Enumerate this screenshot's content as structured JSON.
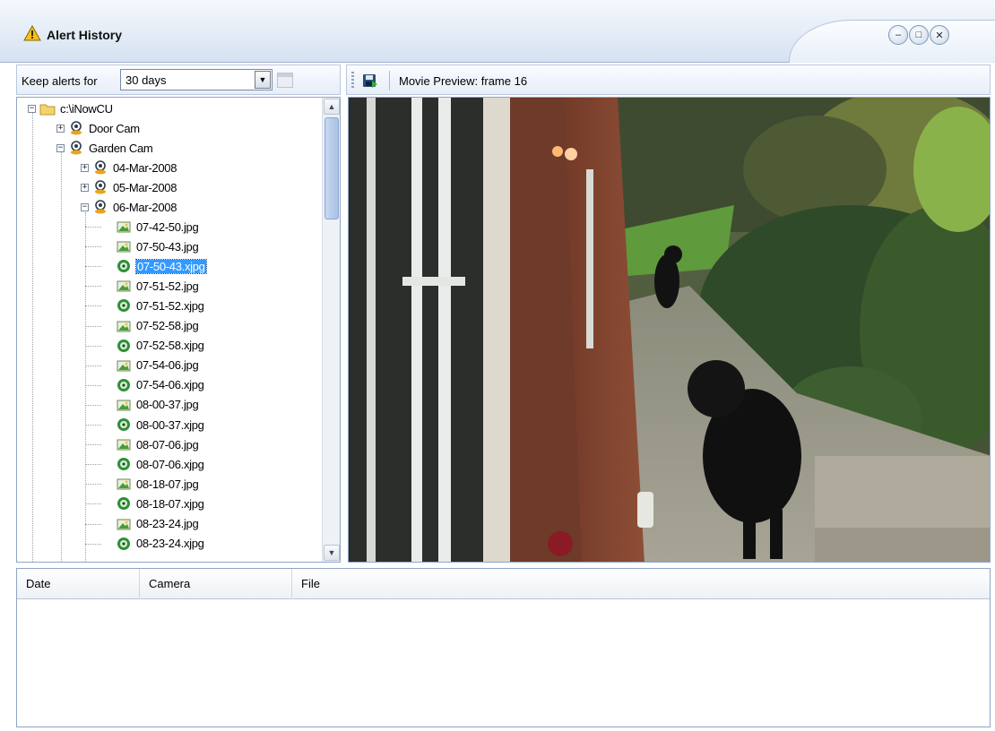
{
  "window": {
    "title": "Alert History",
    "controls": [
      "minimize",
      "maximize",
      "close"
    ]
  },
  "left_toolbar": {
    "keep_label": "Keep alerts for",
    "keep_value": "30 days"
  },
  "preview_toolbar": {
    "title": "Movie Preview: frame 16"
  },
  "tree": {
    "root": "c:\\iNowCU",
    "cameras": [
      "Door Cam",
      "Garden Cam"
    ],
    "dates": [
      "04-Mar-2008",
      "05-Mar-2008",
      "06-Mar-2008"
    ],
    "files": [
      {
        "name": "07-42-50.jpg",
        "kind": "jpg"
      },
      {
        "name": "07-50-43.jpg",
        "kind": "jpg"
      },
      {
        "name": "07-50-43.xjpg",
        "kind": "xjpg",
        "selected": true
      },
      {
        "name": "07-51-52.jpg",
        "kind": "jpg"
      },
      {
        "name": "07-51-52.xjpg",
        "kind": "xjpg"
      },
      {
        "name": "07-52-58.jpg",
        "kind": "jpg"
      },
      {
        "name": "07-52-58.xjpg",
        "kind": "xjpg"
      },
      {
        "name": "07-54-06.jpg",
        "kind": "jpg"
      },
      {
        "name": "07-54-06.xjpg",
        "kind": "xjpg"
      },
      {
        "name": "08-00-37.jpg",
        "kind": "jpg"
      },
      {
        "name": "08-00-37.xjpg",
        "kind": "xjpg"
      },
      {
        "name": "08-07-06.jpg",
        "kind": "jpg"
      },
      {
        "name": "08-07-06.xjpg",
        "kind": "xjpg"
      },
      {
        "name": "08-18-07.jpg",
        "kind": "jpg"
      },
      {
        "name": "08-18-07.xjpg",
        "kind": "xjpg"
      },
      {
        "name": "08-23-24.jpg",
        "kind": "jpg"
      },
      {
        "name": "08-23-24.xjpg",
        "kind": "xjpg"
      }
    ]
  },
  "alert_list": {
    "columns": [
      "Date",
      "Camera",
      "File"
    ],
    "rows": []
  },
  "colors": {
    "selection": "#3399ff",
    "chrome": "#d6e2f1",
    "border": "#8fa5c2"
  }
}
